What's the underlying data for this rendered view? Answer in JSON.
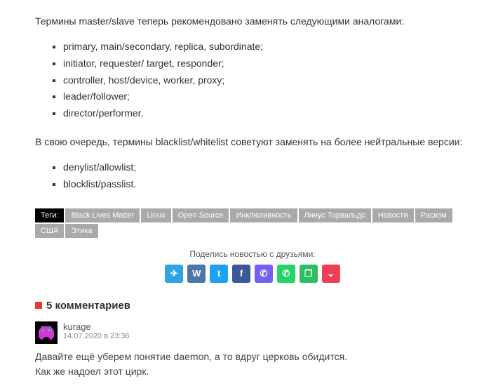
{
  "paragraph1": "Термины master/slave теперь рекомендовано заменять следующими аналогами:",
  "list1": [
    "primary, main/secondary, replica, subordinate;",
    "initiator, requester/ target, responder;",
    "controller, host/device, worker, proxy;",
    "leader/follower;",
    "director/performer."
  ],
  "paragraph2": "В свою очередь, термины blacklist/whitelist советуют заменять на более нейтральные версии:",
  "list2": [
    "denylist/allowlist;",
    "blocklist/passlist."
  ],
  "tags": {
    "label": "Теги:",
    "items": [
      "Black Lives Matter",
      "Linux",
      "Open Source",
      "Инклюзивность",
      "Линус Торвальдс",
      "Новости",
      "Расизм",
      "США",
      "Этика"
    ]
  },
  "share": {
    "label": "Поделись новостью с друзьями:",
    "buttons": [
      {
        "name": "telegram-icon",
        "glyph": "✈",
        "cls": "tg"
      },
      {
        "name": "vk-icon",
        "glyph": "W",
        "cls": "vk"
      },
      {
        "name": "twitter-icon",
        "glyph": "t",
        "cls": "tw"
      },
      {
        "name": "facebook-icon",
        "glyph": "f",
        "cls": "fb"
      },
      {
        "name": "viber-icon",
        "glyph": "✆",
        "cls": "vb"
      },
      {
        "name": "whatsapp-icon",
        "glyph": "✆",
        "cls": "wa"
      },
      {
        "name": "evernote-icon",
        "glyph": "❐",
        "cls": "ev"
      },
      {
        "name": "pocket-icon",
        "glyph": "⌄",
        "cls": "pk"
      }
    ]
  },
  "comments": {
    "header": "5 комментариев",
    "items": [
      {
        "author": "kurage",
        "date": "14.07.2020 в 23:36",
        "body": "Давайте ещё уберем понятие daemon, а то вдруг церковь обидится.\nКак же надоел этот цирк."
      }
    ]
  }
}
